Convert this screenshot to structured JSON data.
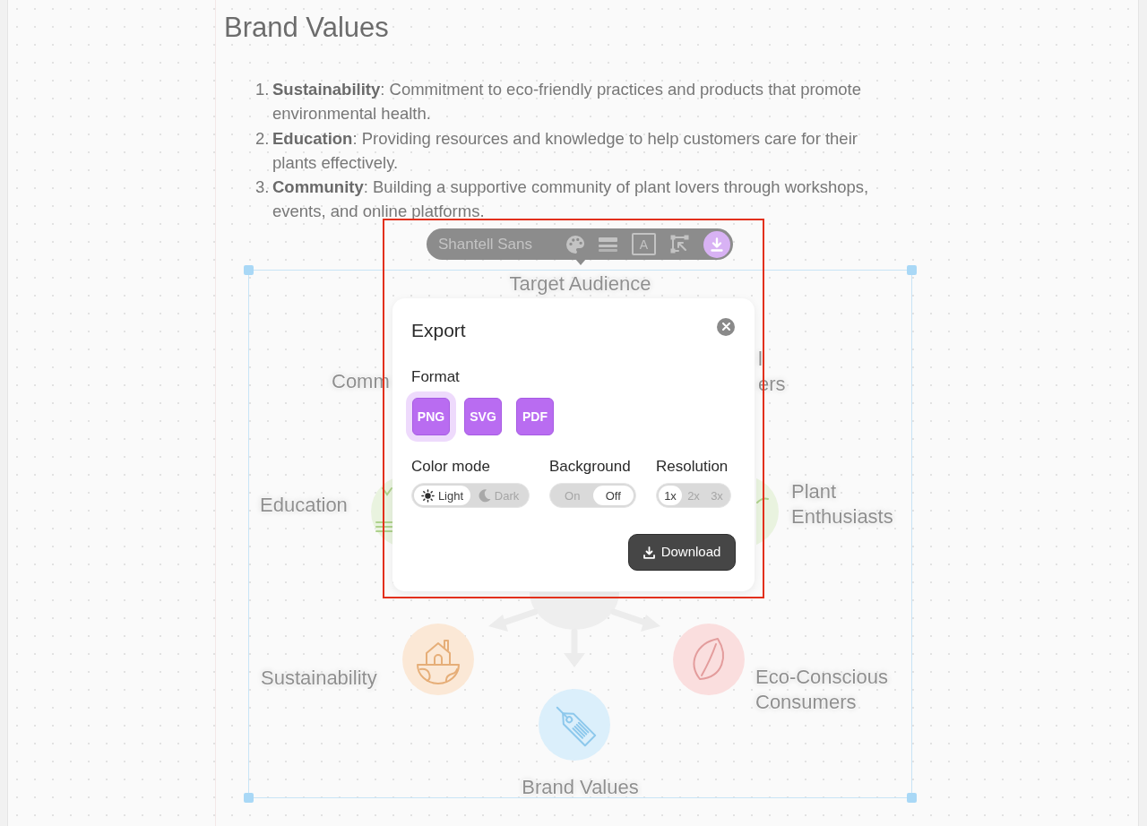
{
  "page": {
    "heading": "Brand Values",
    "values": [
      {
        "number": "1.",
        "text": "**Sustainability**: Commitment to eco-friendly practices and products that promote environmental health."
      },
      {
        "number": "2.",
        "text": "**Education**: Providing resources and knowledge to help customers care for their plants effectively."
      },
      {
        "number": "3.",
        "text": "**Community**: Building a supportive community of plant lovers through workshops, events, and online platforms."
      }
    ]
  },
  "diagram": {
    "title": "Target Audience",
    "nodes": [
      {
        "label": "Comm"
      },
      {
        "fragments": [
          "l",
          "ers"
        ]
      },
      {
        "label": "Education",
        "color": "#e9f3df"
      },
      {
        "label": "Plant Enthusiasts",
        "color": "#e9f3df"
      },
      {
        "label": "Sustainability",
        "color": "#fbe8d6"
      },
      {
        "label": "Eco-Conscious Consumers",
        "color": "#fadede"
      },
      {
        "label": "Brand Values",
        "color": "#dbeffb"
      }
    ]
  },
  "toolbar": {
    "font": "Shantell Sans",
    "tools": [
      {
        "kind": "color",
        "selected": false
      },
      {
        "kind": "stroke",
        "selected": false
      },
      {
        "kind": "text",
        "label": "A",
        "selected": false
      },
      {
        "kind": "frame",
        "selected": false
      },
      {
        "kind": "export",
        "selected": true
      }
    ]
  },
  "export_dialog": {
    "title": "Export",
    "format": {
      "label": "Format",
      "options": [
        {
          "label": "PNG",
          "selected": true
        },
        {
          "label": "SVG",
          "selected": false
        },
        {
          "label": "PDF",
          "selected": false
        }
      ]
    },
    "color_mode": {
      "label": "Color mode",
      "options": [
        {
          "label": "Light",
          "selected": true
        },
        {
          "label": "Dark",
          "selected": false
        }
      ]
    },
    "background": {
      "label": "Background",
      "options": [
        {
          "label": "On",
          "selected": false
        },
        {
          "label": "Off",
          "selected": true
        }
      ]
    },
    "resolution": {
      "label": "Resolution",
      "options": [
        {
          "label": "1x",
          "selected": true
        },
        {
          "label": "2x",
          "selected": false
        },
        {
          "label": "3x",
          "selected": false
        }
      ]
    },
    "download": "Download"
  }
}
